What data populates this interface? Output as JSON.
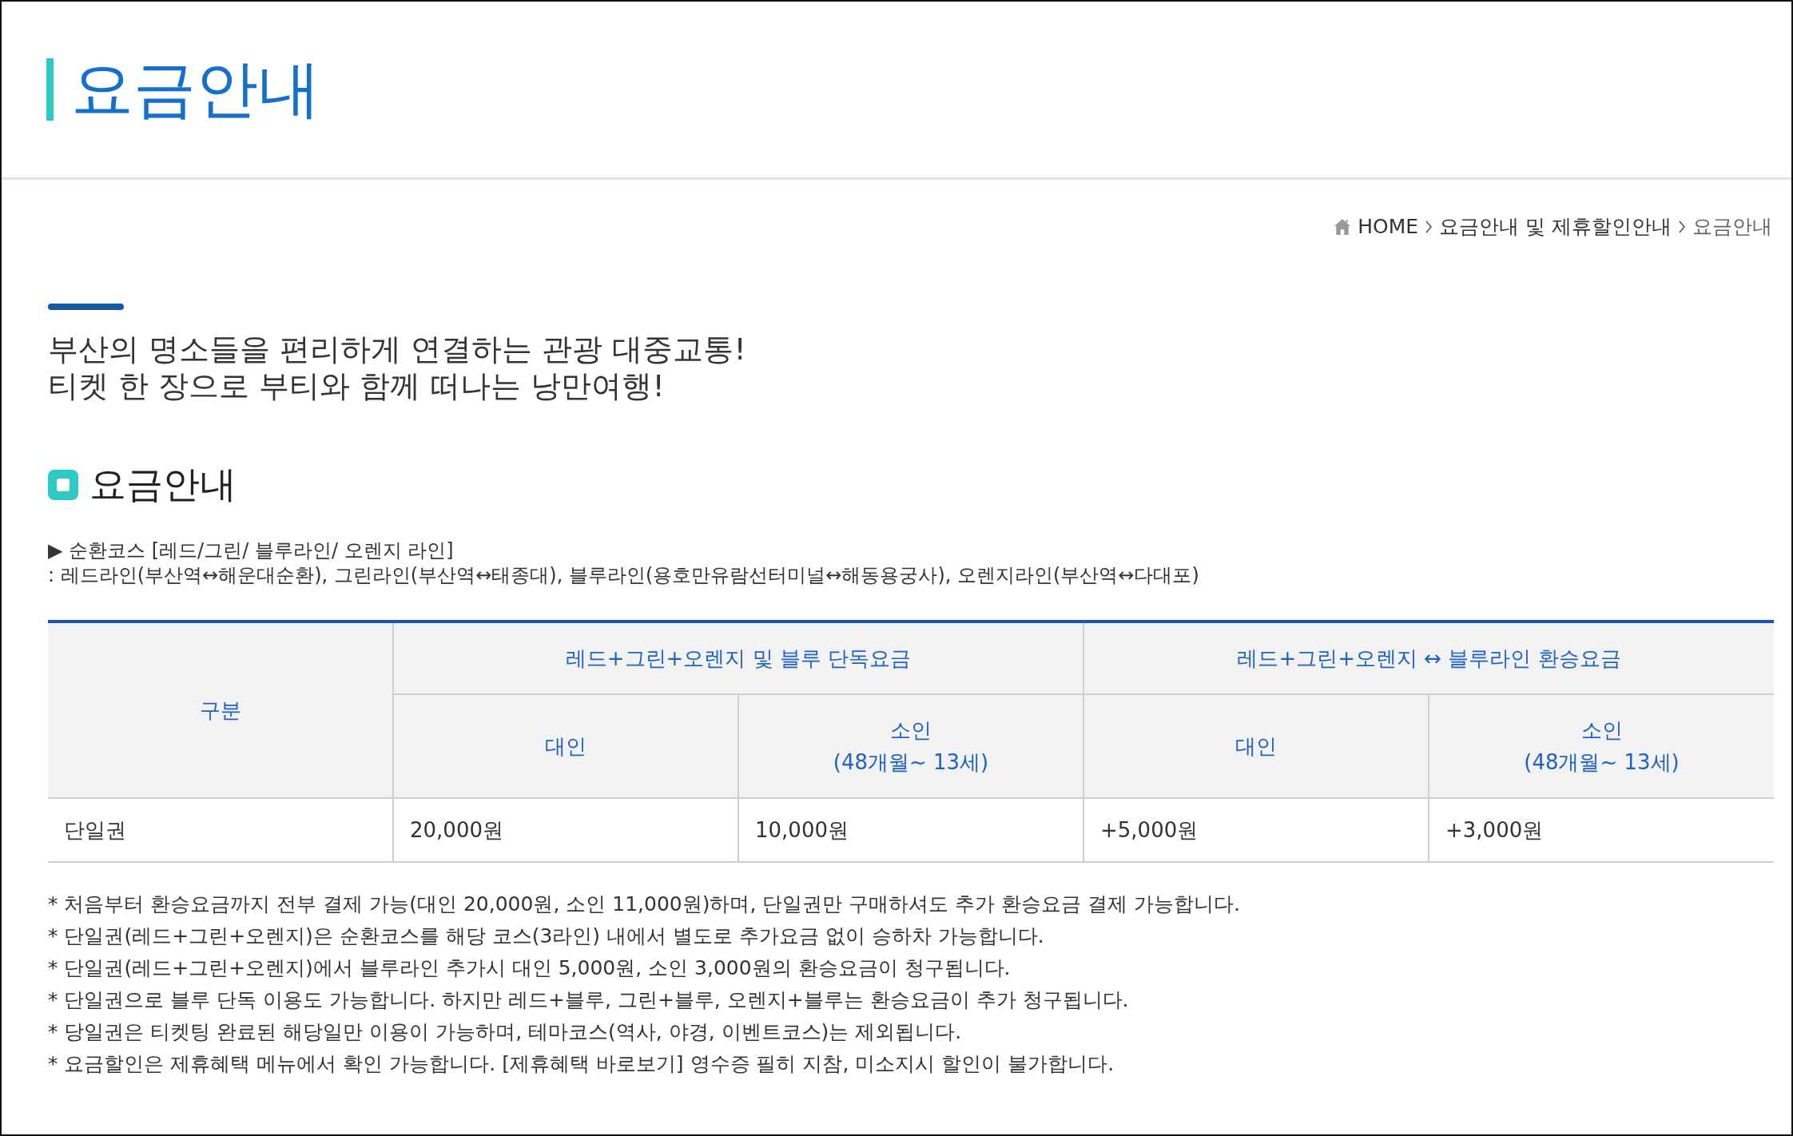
{
  "page_title": "요금안내",
  "breadcrumb": [
    {
      "label": "HOME",
      "kind": "home"
    },
    {
      "label": "요금안내 및 제휴할인안내",
      "kind": "link"
    },
    {
      "label": "요금안내",
      "kind": "current"
    }
  ],
  "intro": [
    "부산의 명소들을 편리하게 연결하는 관광 대중교통!",
    "티켓 한 장으로 부티와 함께 떠나는 낭만여행!"
  ],
  "section_title": "요금안내",
  "course": {
    "heading": "▶ 순환코스 [레드/그린/ 블루라인/ 오렌지 라인]",
    "detail": ": 레드라인(부산역↔해운대순환), 그린라인(부산역↔태종대), 블루라인(용호만유람선터미널↔해동용궁사), 오렌지라인(부산역↔다대포)"
  },
  "table": {
    "corner": "구분",
    "groups": [
      {
        "label": "레드+그린+오렌지 및 블루 단독요금",
        "columns": [
          {
            "label": "대인"
          },
          {
            "label": "소인",
            "sub": "(48개월~ 13세)"
          }
        ]
      },
      {
        "label": "레드+그린+오렌지 ↔ 블루라인 환승요금",
        "columns": [
          {
            "label": "대인"
          },
          {
            "label": "소인",
            "sub": "(48개월~ 13세)"
          }
        ]
      }
    ],
    "rows": [
      {
        "cells": [
          "단일권",
          "20,000원",
          "10,000원",
          "+5,000원",
          "+3,000원"
        ]
      }
    ]
  },
  "notes": [
    "* 처음부터 환승요금까지 전부 결제 가능(대인 20,000원, 소인 11,000원)하며, 단일권만 구매하셔도 추가 환승요금 결제 가능합니다.",
    "* 단일권(레드+그린+오렌지)은 순환코스를 해당 코스(3라인) 내에서 별도로 추가요금 없이 승하차 가능합니다.",
    "* 단일권(레드+그린+오렌지)에서 블루라인 추가시 대인 5,000원, 소인 3,000원의 환승요금이 청구됩니다.",
    "* 단일권으로 블루 단독 이용도 가능합니다. 하지만 레드+블루, 그린+블루, 오렌지+블루는 환승요금이 추가 청구됩니다.",
    "* 당일권은 티켓팅 완료된 해당일만 이용이 가능하며, 테마코스(역사, 야경, 이벤트코스)는 제외됩니다.",
    "* 요금할인은 제휴혜택 메뉴에서 확인 가능합니다. [제휴혜택 바로보기] 영수증 필히 지참, 미소지시 할인이 불가합니다."
  ]
}
